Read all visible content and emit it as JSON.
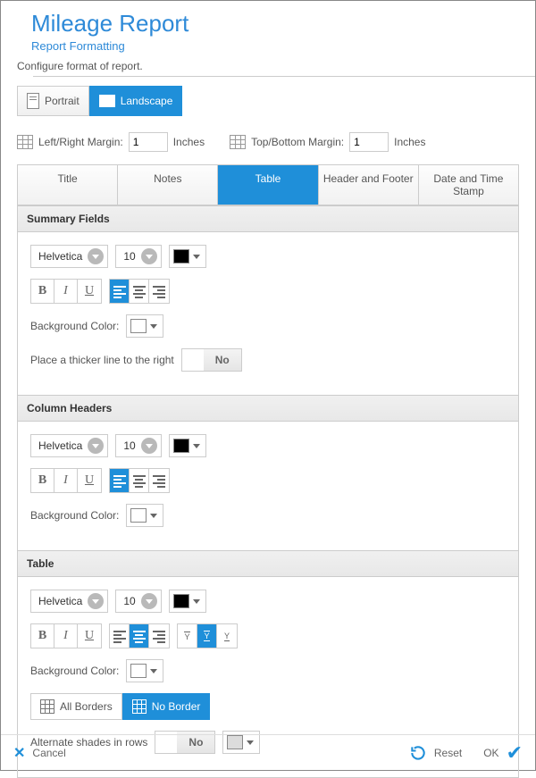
{
  "header": {
    "title": "Mileage Report",
    "subtitle": "Report Formatting",
    "instruction": "Configure format of report."
  },
  "orientation": {
    "portrait": "Portrait",
    "landscape": "Landscape",
    "active": "Landscape"
  },
  "margins": {
    "left_label": "Left/Right Margin:",
    "left_value": "1",
    "top_label": "Top/Bottom Margin:",
    "top_value": "1",
    "units": "Inches"
  },
  "tabs": {
    "items": [
      "Title",
      "Notes",
      "Table",
      "Header and Footer",
      "Date and Time Stamp"
    ],
    "active": "Table"
  },
  "panels": {
    "summary": {
      "title": "Summary Fields",
      "font": "Helvetica",
      "size": "10",
      "color": "#000000",
      "bg_label": "Background Color:",
      "bg_color": "#ffffff",
      "thicker_label": "Place a thicker line to the right",
      "toggle": "No"
    },
    "columns": {
      "title": "Column Headers",
      "font": "Helvetica",
      "size": "10",
      "color": "#000000",
      "bg_label": "Background Color:",
      "bg_color": "#ffffff"
    },
    "table": {
      "title": "Table",
      "font": "Helvetica",
      "size": "10",
      "color": "#000000",
      "bg_label": "Background Color:",
      "bg_color": "#ffffff",
      "all_borders": "All Borders",
      "no_border": "No Border",
      "alt_label": "Alternate shades in rows",
      "alt_toggle": "No",
      "alt_color": "#dcdcdc"
    }
  },
  "footer": {
    "cancel": "Cancel",
    "reset": "Reset",
    "ok": "OK"
  }
}
